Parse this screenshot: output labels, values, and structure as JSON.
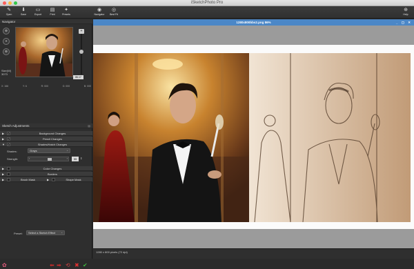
{
  "window": {
    "title": "iSketchPhoto Pro"
  },
  "toolbar": {
    "buttons": [
      {
        "label": "Open",
        "icon": "open-icon"
      },
      {
        "label": "Save",
        "icon": "save-icon"
      },
      {
        "label": "Export",
        "icon": "export-icon"
      },
      {
        "label": "Print",
        "icon": "print-icon"
      },
      {
        "label": "Presets",
        "icon": "presets-icon"
      },
      {
        "label": "Navigator",
        "icon": "navigator-icon"
      },
      {
        "label": "Best Fit",
        "icon": "best-fit-icon"
      },
      {
        "label": "Help",
        "icon": "help-icon"
      }
    ]
  },
  "navigator": {
    "title": "Navigator",
    "size_label": "Size(W)",
    "size_value": "3073",
    "zoom_value": "86.17",
    "coords": [
      "X: 166",
      "Y: 6",
      "R: 000",
      "G: 000",
      "B: 000"
    ]
  },
  "adjustments": {
    "title": "Sketch Adjustments",
    "rows": [
      {
        "label": "Background Changes",
        "checked": true
      },
      {
        "label": "Pencil Changes",
        "checked": true
      },
      {
        "label": "Shades/Hatch Changes",
        "checked": true
      }
    ],
    "shades_label": "Shades:",
    "shades_value": "Grays",
    "strength_label": "Strength:",
    "strength_value": "55",
    "color_changes": "Color Changes",
    "borders": "Borders",
    "brush_mask": "Brush Mask",
    "shape_mask": "Shape Mask"
  },
  "preset": {
    "label": "Preset:",
    "value": "Select a Sketch Effect"
  },
  "document": {
    "title": "1280x800bbs2.png 86%",
    "status": "1280 x 800 pixels (72 dpi)"
  },
  "colors": {
    "accent": "#4b87c7",
    "panel": "#2e2e2e",
    "sepia": "#b58d68"
  }
}
